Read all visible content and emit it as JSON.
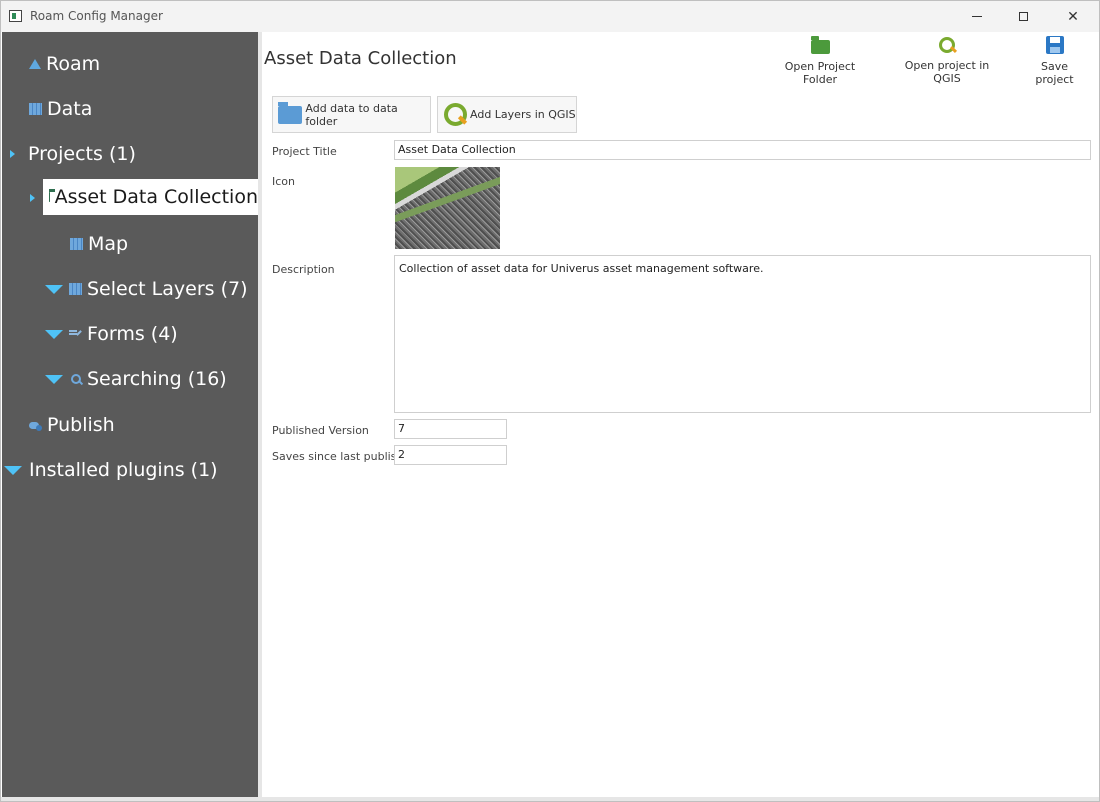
{
  "window": {
    "title": "Roam Config Manager"
  },
  "sidebar": {
    "items": [
      {
        "label": "Roam"
      },
      {
        "label": "Data"
      },
      {
        "label": "Projects (1)"
      },
      {
        "label": "Asset Data Collection"
      },
      {
        "label": "Map"
      },
      {
        "label": "Select Layers (7)"
      },
      {
        "label": "Forms (4)"
      },
      {
        "label": "Searching (16)"
      },
      {
        "label": "Publish"
      },
      {
        "label": "Installed plugins (1)"
      }
    ]
  },
  "header": {
    "title": "Asset Data Collection",
    "toolbar": {
      "open_folder": "Open Project Folder",
      "open_qgis": "Open project in QGIS",
      "save": "Save project"
    }
  },
  "actions": {
    "add_data": "Add data to data folder",
    "add_layers": "Add Layers in QGIS"
  },
  "form": {
    "project_title_label": "Project Title",
    "project_title_value": "Asset Data Collection",
    "icon_label": "Icon",
    "description_label": "Description",
    "description_value": "Collection of asset data for Univerus asset management software.",
    "published_version_label": "Published Version",
    "published_version_value": "7",
    "saves_label": "Saves since last publish",
    "saves_value": "2"
  }
}
